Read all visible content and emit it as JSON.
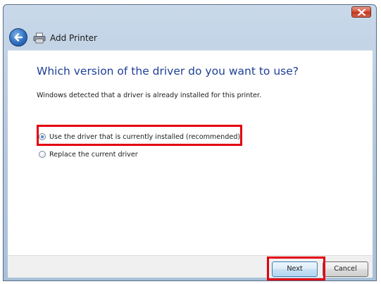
{
  "window": {
    "title": "Add Printer",
    "close_icon": "close-icon",
    "back_icon": "back-arrow-icon",
    "printer_icon": "printer-icon"
  },
  "main": {
    "heading": "Which version of the driver do you want to use?",
    "description": "Windows detected that a driver is already installed for this printer.",
    "options": [
      {
        "label": "Use the driver that is currently installed (recommended)",
        "selected": true
      },
      {
        "label": "Replace the current driver",
        "selected": false
      }
    ]
  },
  "footer": {
    "next_label": "Next",
    "cancel_label": "Cancel"
  },
  "colors": {
    "heading": "#1e3f96",
    "highlight": "#e3000f",
    "close_button": "#d5533c"
  }
}
